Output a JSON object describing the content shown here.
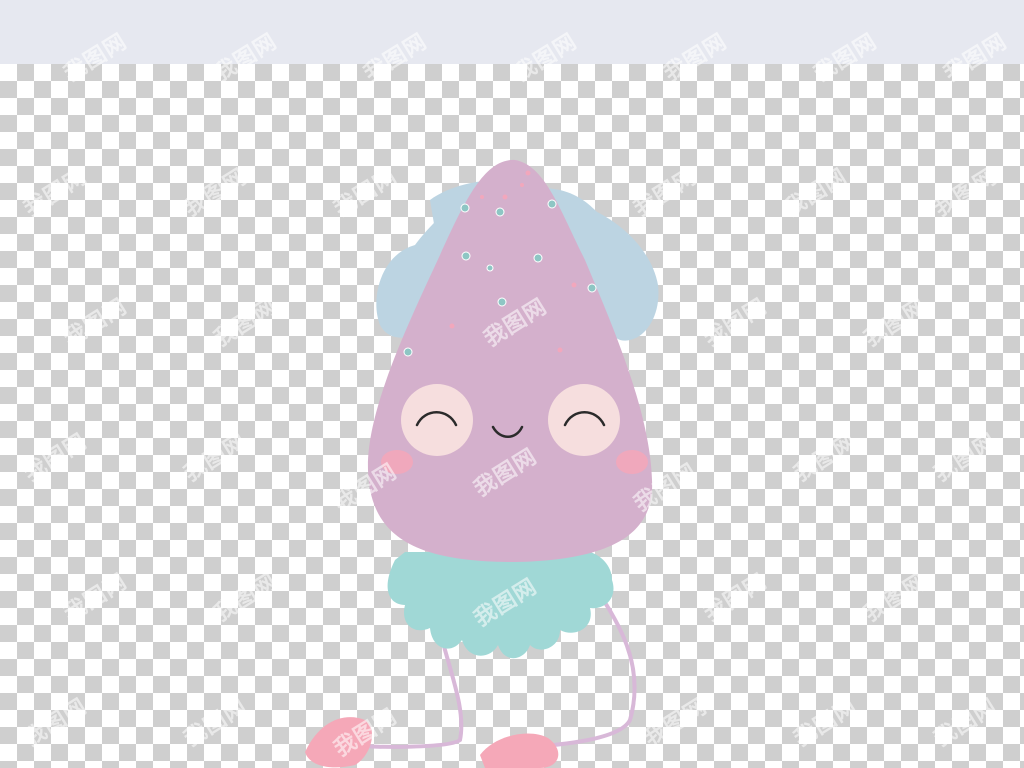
{
  "image": {
    "subject": "squid-illustration",
    "colors": {
      "body": "#d4b0cc",
      "fin": "#bcd4e2",
      "tentacles": "#a0d8d6",
      "cheeks": "#f6dede",
      "blush": "#f4a7b9",
      "feet": "#f5a8b8",
      "strings": "#d8b8d8",
      "header": "#e6e8f0",
      "checker": "#cfcfcf"
    }
  },
  "watermark": {
    "text": "我图网"
  }
}
